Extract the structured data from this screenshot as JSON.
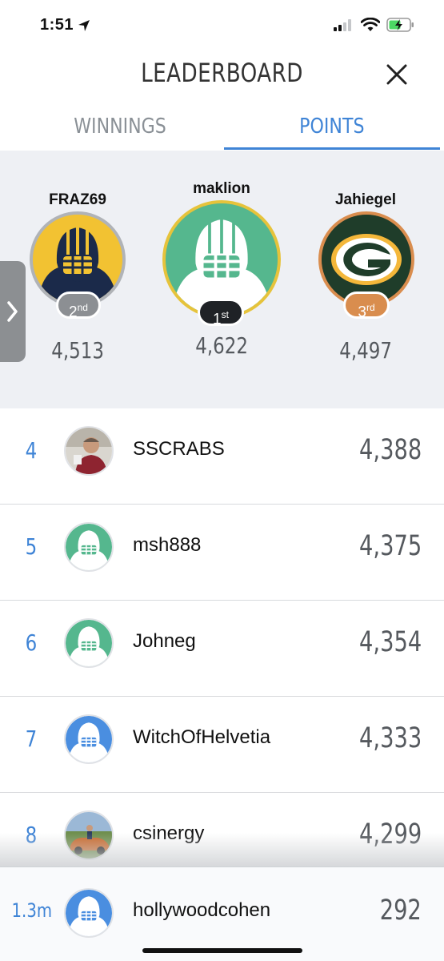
{
  "status_bar": {
    "time": "1:51"
  },
  "header": {
    "title": "LEADERBOARD"
  },
  "tabs": [
    {
      "label": "WINNINGS",
      "active": false
    },
    {
      "label": "POINTS",
      "active": true
    }
  ],
  "podium": {
    "first": {
      "name": "maklion",
      "rank": "1",
      "suffix": "st",
      "points": "4,622",
      "badge_color": "#1f2226",
      "avatar": "green-football-player-icon"
    },
    "second": {
      "name": "FRAZ69",
      "rank": "2",
      "suffix": "nd",
      "points": "4,513",
      "badge_color": "#8c8f93",
      "avatar": "navy-gold-football-player-icon"
    },
    "third": {
      "name": "Jahiegel",
      "rank": "3",
      "suffix": "rd",
      "points": "4,497",
      "badge_color": "#d98d4e",
      "avatar": "packers-g-logo-icon"
    }
  },
  "rows": [
    {
      "rank": "4",
      "name": "SSCRABS",
      "points": "4,388",
      "avatar": "user-photo"
    },
    {
      "rank": "5",
      "name": "msh888",
      "points": "4,375",
      "avatar": "green-football-player-icon"
    },
    {
      "rank": "6",
      "name": "Johneg",
      "points": "4,354",
      "avatar": "green-football-player-icon"
    },
    {
      "rank": "7",
      "name": "WitchOfHelvetia",
      "points": "4,333",
      "avatar": "blue-football-player-icon"
    },
    {
      "rank": "8",
      "name": "csinergy",
      "points": "4,299",
      "avatar": "car-photo"
    }
  ],
  "current_user": {
    "rank": "1.3m",
    "name": "hollywoodcohen",
    "points": "292",
    "avatar": "blue-football-player-icon"
  },
  "colors": {
    "accent": "#3f84d6",
    "podium_bg": "#eef0f4",
    "gold": "#e6c33b",
    "bronze": "#d98d4e",
    "green": "#55b78e",
    "blue": "#4a8ee0"
  }
}
